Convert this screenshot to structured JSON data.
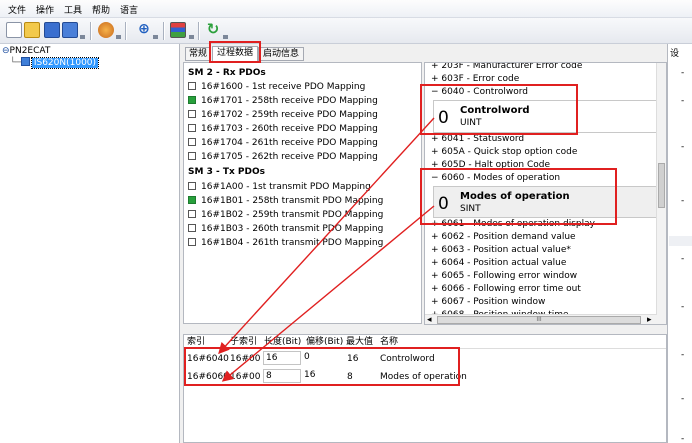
{
  "menu": [
    "文件",
    "操作",
    "工具",
    "帮助",
    "语言"
  ],
  "tree": {
    "root": "PN2ECAT",
    "child": "IS620N(1000)"
  },
  "tabs": [
    "常规",
    "过程数据",
    "启动信息"
  ],
  "rx": {
    "title": "SM 2 - Rx PDOs",
    "items": [
      {
        "label": "16#1600  -  1st receive PDO Mapping",
        "checked": false
      },
      {
        "label": "16#1701  -  258th receive PDO Mapping",
        "checked": true
      },
      {
        "label": "16#1702  -  259th receive PDO Mapping",
        "checked": false
      },
      {
        "label": "16#1703  -  260th receive PDO Mapping",
        "checked": false
      },
      {
        "label": "16#1704  -  261th receive PDO Mapping",
        "checked": false
      },
      {
        "label": "16#1705  -  262th receive PDO Mapping",
        "checked": false
      }
    ]
  },
  "tx": {
    "title": "SM 3 - Tx PDOs",
    "items": [
      {
        "label": "16#1A00  -  1st transmit PDO Mapping",
        "checked": false
      },
      {
        "label": "16#1B01  -  258th transmit PDO Mapping",
        "checked": true
      },
      {
        "label": "16#1B02  -  259th transmit PDO Mapping",
        "checked": false
      },
      {
        "label": "16#1B03  -  260th transmit PDO Mapping",
        "checked": false
      },
      {
        "label": "16#1B04  -  261th transmit PDO Mapping",
        "checked": false
      }
    ]
  },
  "objects": {
    "top": [
      {
        "sign": "+",
        "label": "203F - Manufacturer Error code"
      },
      {
        "sign": "+",
        "label": "603F - Error code"
      },
      {
        "sign": "−",
        "label": "6040 - Controlword"
      }
    ],
    "detail1": {
      "value": "0",
      "name": "Controlword",
      "type": "UINT"
    },
    "mid": [
      {
        "sign": "+",
        "label": "6041 - Statusword"
      },
      {
        "sign": "+",
        "label": "605A - Quick stop option code"
      },
      {
        "sign": "+",
        "label": "605D - Halt option Code"
      },
      {
        "sign": "−",
        "label": "6060 - Modes of operation"
      }
    ],
    "detail2": {
      "value": "0",
      "name": "Modes of operation",
      "type": "SINT"
    },
    "bottom": [
      {
        "sign": "+",
        "label": "6061 - Modes of operation display"
      },
      {
        "sign": "+",
        "label": "6062 - Position demand value"
      },
      {
        "sign": "+",
        "label": "6063 - Position actual value*"
      },
      {
        "sign": "+",
        "label": "6064 - Position actual value"
      },
      {
        "sign": "+",
        "label": "6065 - Following error window"
      },
      {
        "sign": "+",
        "label": "6066 - Following error time out"
      },
      {
        "sign": "+",
        "label": "6067 - Position window"
      },
      {
        "sign": "+",
        "label": "6068 - Position window time"
      }
    ],
    "scroll_mark": "III"
  },
  "table": {
    "headers": [
      "索引",
      "子索引",
      "长度(Bit)",
      "偏移(Bit)",
      "最大值",
      "名称"
    ],
    "rows": [
      [
        "16#6040",
        "16#00",
        "16",
        "0",
        "16",
        "Controlword"
      ],
      [
        "16#6060",
        "16#00",
        "8",
        "16",
        "8",
        "Modes of operation"
      ]
    ]
  },
  "rightpanel": {
    "title": "设"
  }
}
